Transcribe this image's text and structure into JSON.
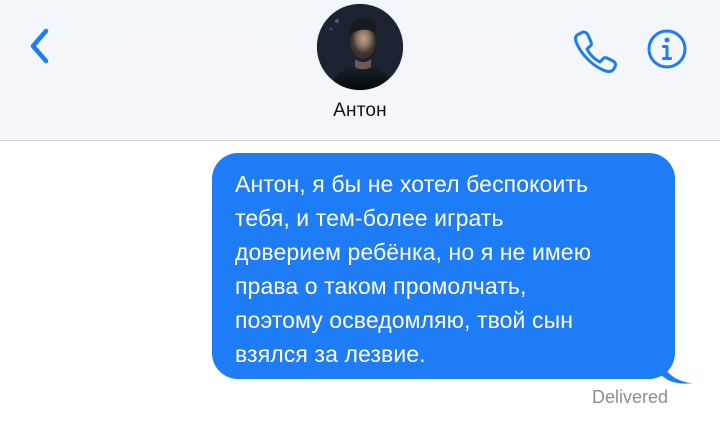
{
  "header": {
    "contact_name": "Антон",
    "back_icon": "chevron-left-icon",
    "call_icon": "phone-icon",
    "info_icon": "info-icon",
    "accent_color": "#1f7cf7"
  },
  "conversation": {
    "messages": [
      {
        "lines": [
          "Антон, я бы не хотел беспокоить",
          "тебя, и тем-более играть",
          "доверием ребёнка, но я не имею",
          "права о таком промолчать,",
          "поэтому осведомляю, твой сын",
          "взялся за лезвие."
        ],
        "status": "Delivered"
      }
    ]
  }
}
